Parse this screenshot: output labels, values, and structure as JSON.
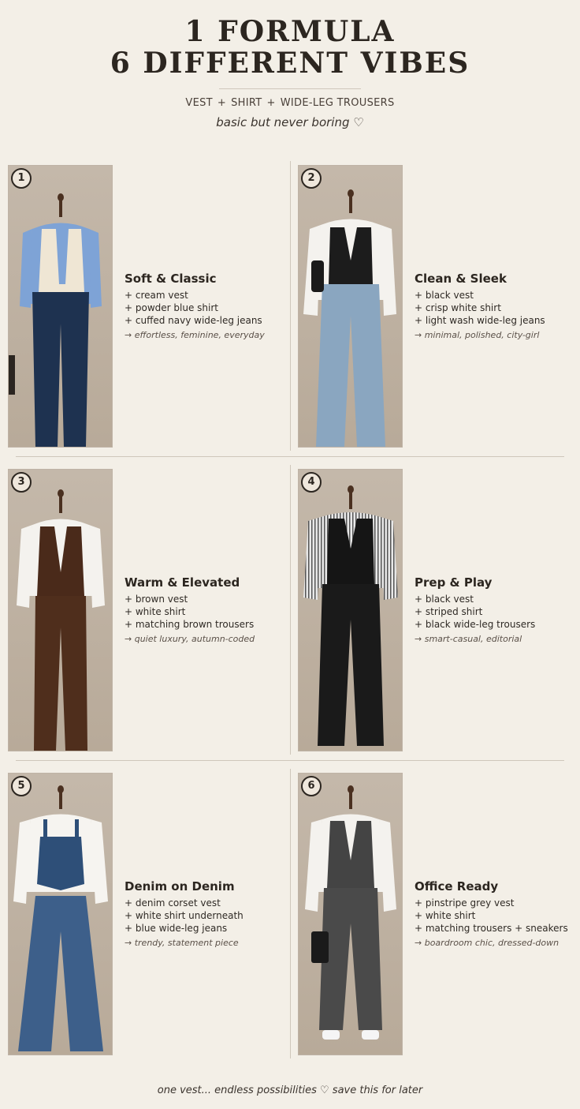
{
  "header": {
    "title_line1": "1 FORMULA",
    "title_line2": "6 DIFFERENT VIBES",
    "formula": [
      "VEST",
      "SHIRT",
      "WIDE-LEG TROUSERS"
    ],
    "plus": "+",
    "tagline": "basic but never boring ♡"
  },
  "outfits": [
    {
      "number": "1",
      "name": "Soft & Classic",
      "items": [
        "+ cream vest",
        "+ powder blue shirt",
        "+ cuffed navy wide-leg jeans"
      ],
      "vibe": "→ effortless, feminine, everyday"
    },
    {
      "number": "2",
      "name": "Clean & Sleek",
      "items": [
        "+ black vest",
        "+ crisp white shirt",
        "+ light wash wide-leg jeans"
      ],
      "vibe": "→ minimal, polished, city-girl"
    },
    {
      "number": "3",
      "name": "Warm & Elevated",
      "items": [
        "+ brown vest",
        "+ white shirt",
        "+ matching brown trousers"
      ],
      "vibe": "→ quiet luxury, autumn-coded"
    },
    {
      "number": "4",
      "name": "Prep & Play",
      "items": [
        "+ black vest",
        "+ striped shirt",
        "+ black wide-leg trousers"
      ],
      "vibe": "→ smart-casual, editorial"
    },
    {
      "number": "5",
      "name": "Denim on Denim",
      "items": [
        "+ denim corset vest",
        "+ white shirt underneath",
        "+ blue wide-leg jeans"
      ],
      "vibe": "→ trendy, statement piece"
    },
    {
      "number": "6",
      "name": "Office Ready",
      "items": [
        "+ pinstripe grey vest",
        "+ white shirt",
        "+ matching trousers + sneakers"
      ],
      "vibe": "→ boardroom chic, dressed-down"
    }
  ],
  "footer": "one vest... endless possibilities ♡  save this for later"
}
